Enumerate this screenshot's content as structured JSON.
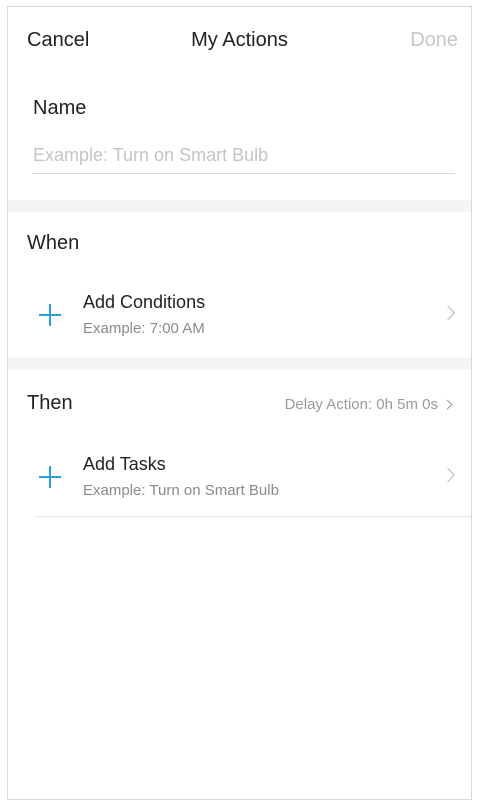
{
  "nav": {
    "cancel": "Cancel",
    "title": "My Actions",
    "done": "Done"
  },
  "name": {
    "label": "Name",
    "value": "",
    "placeholder": "Example: Turn on Smart Bulb"
  },
  "when": {
    "heading": "When",
    "row": {
      "title": "Add Conditions",
      "subtitle": "Example: 7:00 AM"
    }
  },
  "then": {
    "heading": "Then",
    "delay": "Delay Action: 0h 5m 0s",
    "row": {
      "title": "Add Tasks",
      "subtitle": "Example: Turn on Smart Bulb"
    }
  },
  "icons": {
    "add": "plus-icon",
    "navigate": "chevron-right-icon"
  },
  "colors": {
    "accent": "#2b9ee3",
    "done_disabled": "#c6c6c6",
    "separator": "#f5f5f5"
  }
}
